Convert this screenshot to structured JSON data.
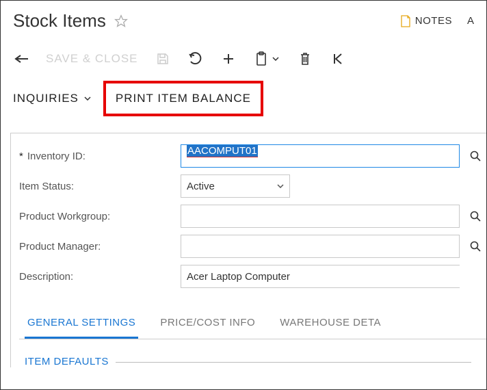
{
  "header": {
    "title": "Stock Items",
    "notes_label": "NOTES",
    "cutoff": "A"
  },
  "toolbar": {
    "save_close_label": "SAVE & CLOSE"
  },
  "subtoolbar": {
    "inquiries_label": "INQUIRIES",
    "print_label": "PRINT ITEM BALANCE"
  },
  "form": {
    "labels": {
      "inventory_id": "Inventory ID:",
      "item_status": "Item Status:",
      "product_workgroup": "Product Workgroup:",
      "product_manager": "Product Manager:",
      "description": "Description:"
    },
    "values": {
      "inventory_id": "AACOMPUT01",
      "item_status": "Active",
      "product_workgroup": "",
      "product_manager": "",
      "description": "Acer Laptop Computer"
    }
  },
  "tabs": {
    "general": "GENERAL SETTINGS",
    "price": "PRICE/COST INFO",
    "warehouse": "WAREHOUSE DETA"
  },
  "section": {
    "item_defaults": "ITEM DEFAULTS"
  }
}
